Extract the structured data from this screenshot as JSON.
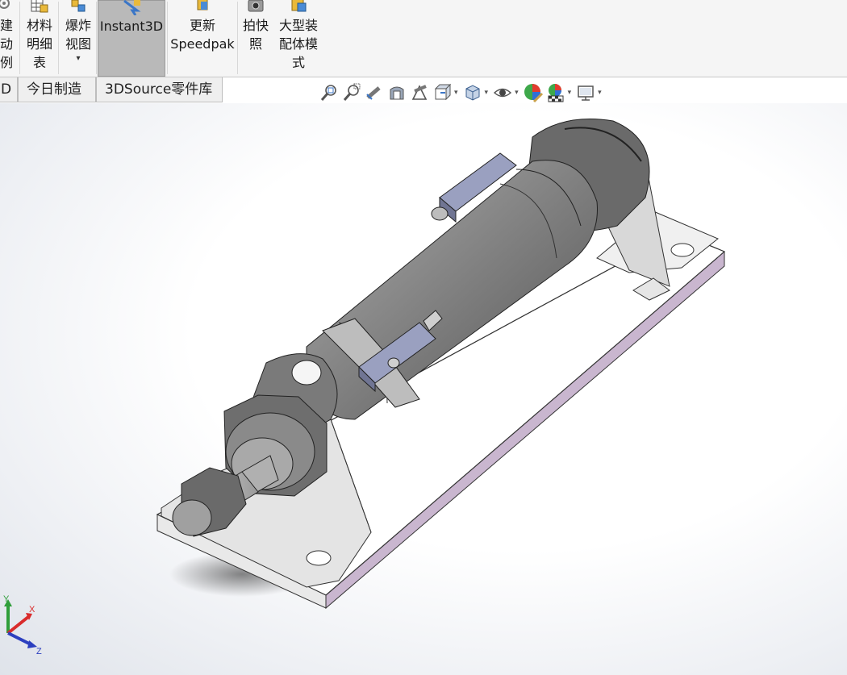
{
  "ribbon": {
    "buttons": [
      {
        "label": "建\n动\n例",
        "icon": "motion-study-icon"
      },
      {
        "label": "材料\n明细\n表",
        "icon": "bill-of-materials-icon"
      },
      {
        "label": "爆炸\n视图",
        "icon": "exploded-view-icon"
      },
      {
        "label": "Instant3D",
        "icon": "instant3d-icon",
        "active": true
      },
      {
        "label": "更新\nSpeedpak",
        "icon": "speedpak-icon"
      },
      {
        "label": "拍快\n照",
        "icon": "snapshot-camera-icon"
      },
      {
        "label": "大型装\n配体模\n式",
        "icon": "large-assembly-mode-icon"
      }
    ]
  },
  "tabs": [
    {
      "label": "D"
    },
    {
      "label": "今日制造"
    },
    {
      "label": "3DSource零件库"
    }
  ],
  "view_toolbar": [
    {
      "icon": "zoom-to-fit-icon"
    },
    {
      "icon": "zoom-to-area-icon"
    },
    {
      "icon": "previous-view-icon"
    },
    {
      "icon": "section-view-icon"
    },
    {
      "icon": "dynamic-annotation-view-icon"
    },
    {
      "icon": "view-orientation-icon"
    },
    {
      "icon": "display-style-icon"
    },
    {
      "icon": "hide-show-items-icon"
    },
    {
      "icon": "edit-appearance-icon"
    },
    {
      "icon": "apply-scene-icon"
    },
    {
      "icon": "view-settings-icon"
    }
  ],
  "triad": {
    "x": "X",
    "y": "Y",
    "z": "Z",
    "colors": {
      "x": "#d92b2b",
      "y": "#2f9e3a",
      "z": "#2c3fbf"
    }
  },
  "colors": {
    "part_gray": "#8d8d8d",
    "plate_edge": "#c9b6cf",
    "active_tab_bg": "#b9b9b9"
  }
}
